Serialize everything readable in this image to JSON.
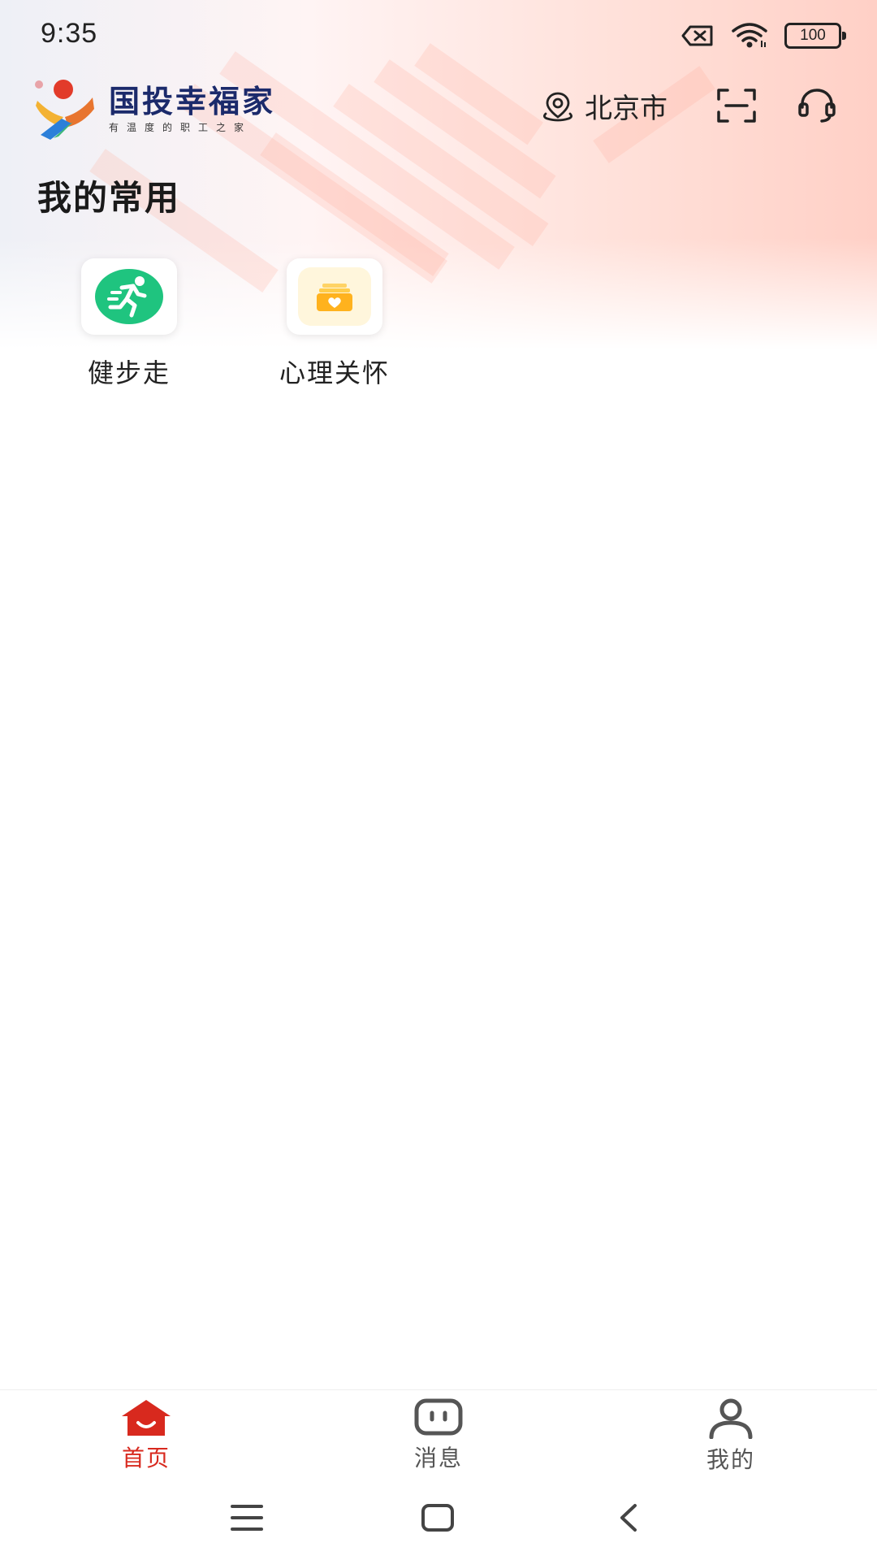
{
  "status_bar": {
    "time": "9:35",
    "battery_level": "100",
    "icons": [
      "no-sim-icon",
      "wifi-icon",
      "battery-icon"
    ]
  },
  "header": {
    "brand_name": "国投幸福家",
    "brand_tagline": "有温度的职工之家",
    "location": "北京市",
    "icons": [
      "location-pin-icon",
      "scan-icon",
      "customer-service-icon"
    ]
  },
  "section": {
    "title": "我的常用"
  },
  "shortcuts": [
    {
      "label": "健步走",
      "icon": "running-person-icon",
      "color": "#1fc47f"
    },
    {
      "label": "心理关怀",
      "icon": "heart-box-icon",
      "color": "#ffc532"
    }
  ],
  "tabbar": {
    "active_color": "#d8291e",
    "inactive_color": "#555555",
    "items": [
      {
        "label": "首页",
        "icon": "home-icon",
        "active": true
      },
      {
        "label": "消息",
        "icon": "message-icon",
        "active": false
      },
      {
        "label": "我的",
        "icon": "person-icon",
        "active": false
      }
    ]
  },
  "system_nav": {
    "icons": [
      "menu-icon",
      "home-square-icon",
      "back-icon"
    ]
  }
}
